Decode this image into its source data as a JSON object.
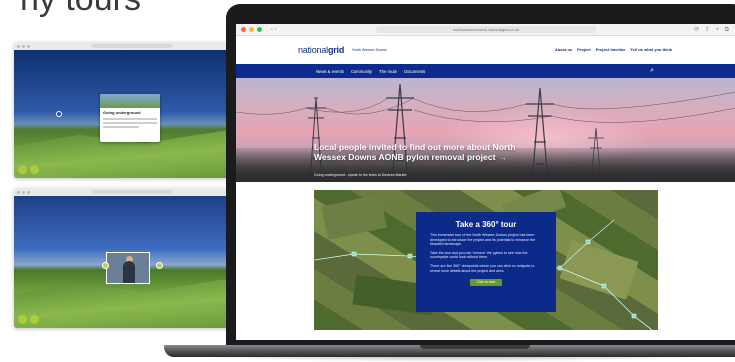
{
  "heading_partial": "ny tours",
  "thumbnails": {
    "first": {
      "popup_title": "Going underground"
    },
    "second": {}
  },
  "browser": {
    "url": "northwessexdowns.nationalgrid.co.uk",
    "nav_arrows": "‹  ›",
    "right_icons": "⟳ ⇪ + ⧉"
  },
  "site": {
    "logo_light": "national",
    "logo_bold": "grid",
    "logo_sub": "North Wessex Downs",
    "header_links": [
      "About us",
      "Project",
      "Project timeline",
      "Tell us what you think"
    ],
    "nav_items": [
      "News & events",
      "Community",
      "The route",
      "Documents"
    ],
    "search_icon": "⌕"
  },
  "hero": {
    "headline": "Local people invited to find out more about North Wessex Downs AONB pylon removal project",
    "arrow": "→",
    "subline": "Going underground - speak to the team at Devizes Market"
  },
  "tour": {
    "title": "Take a 360° tour",
    "paragraphs": [
      "This immersive tour of the North Wessex Downs project has been developed to introduce the project and its potential to enhance the beautiful landscape.",
      "Take the tour and you can 'remove' the pylons to see how the countryside could look without them.",
      "There are five 360° viewpoints where you can click on hotspots to reveal more details about the project and area."
    ],
    "button": "Click to start"
  },
  "colors": {
    "brand_blue": "#0d2b8c",
    "accent_green": "#6a9a2c"
  }
}
